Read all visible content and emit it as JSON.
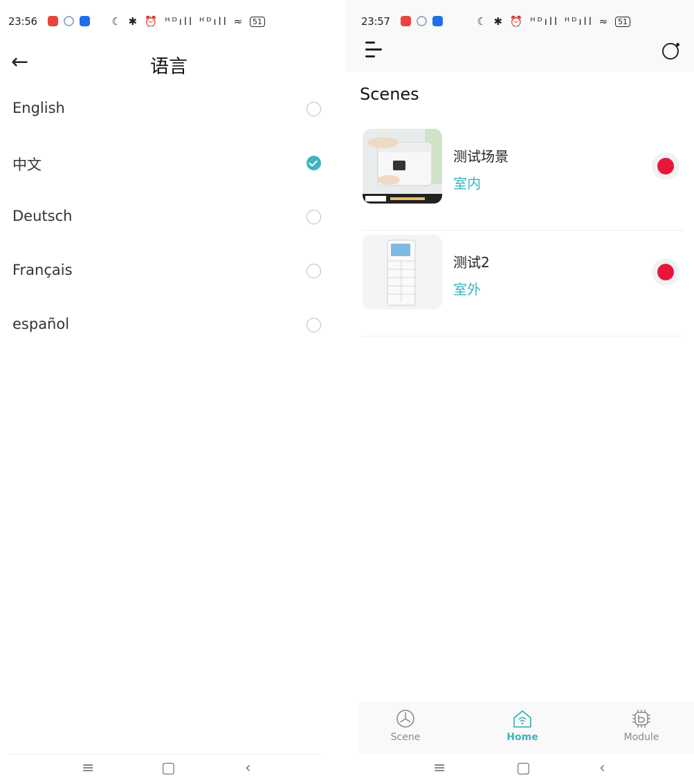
{
  "left_screen": {
    "status_bar": {
      "time": "23:56",
      "icons": "☾ ✱ ⏰ ᴴᴰıll ᴴᴰıll ≈",
      "battery": "51"
    },
    "title": "语言",
    "languages": [
      {
        "label": "English",
        "selected": false
      },
      {
        "label": "中文",
        "selected": true
      },
      {
        "label": "Deutsch",
        "selected": false
      },
      {
        "label": "Français",
        "selected": false
      },
      {
        "label": "español",
        "selected": false
      }
    ],
    "nav": {
      "menu": "≡",
      "home": "▢",
      "back": "‹"
    }
  },
  "right_screen": {
    "status_bar": {
      "time": "23:57",
      "icons": "☾ ✱ ⏰ ᴴᴰıll ᴴᴰıll ≈",
      "battery": "51"
    },
    "section_title": "Scenes",
    "scenes": [
      {
        "name": "测试场景",
        "location": "室内",
        "status_color": "#e8163c"
      },
      {
        "name": "测试2",
        "location": "室外",
        "status_color": "#e8163c"
      }
    ],
    "tabs": [
      {
        "label": "Scene",
        "icon": "scene-icon",
        "active": false
      },
      {
        "label": "Home",
        "icon": "home-icon",
        "active": true
      },
      {
        "label": "Module",
        "icon": "module-icon",
        "active": false
      }
    ],
    "nav": {
      "menu": "≡",
      "home": "▢",
      "back": "‹"
    }
  },
  "colors": {
    "accent": "#3fb4bd",
    "status_red": "#e8163c"
  }
}
